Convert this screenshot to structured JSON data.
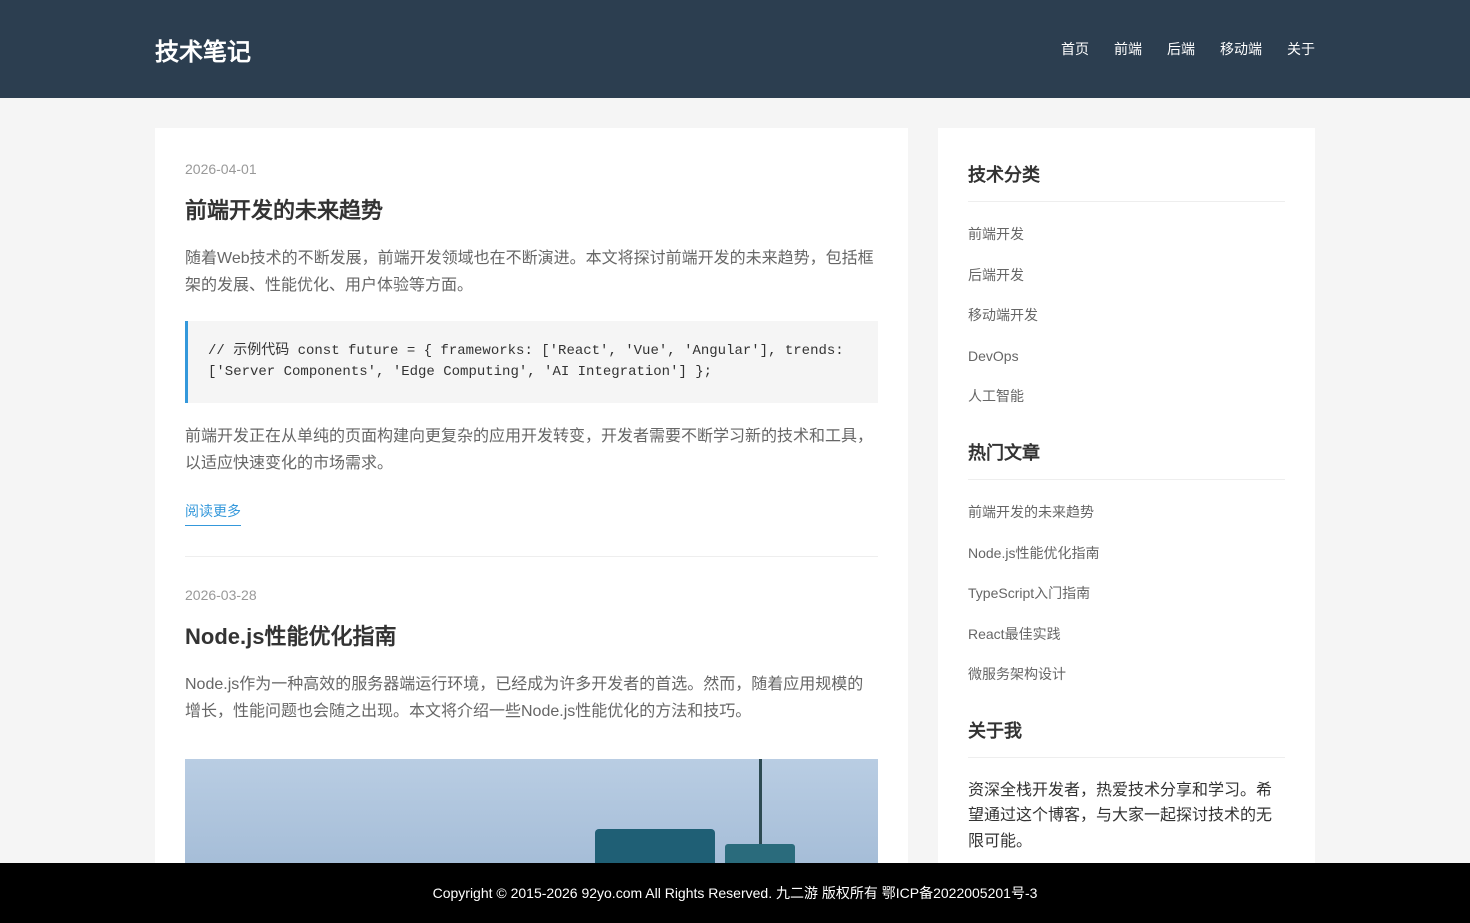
{
  "header": {
    "logo": "技术笔记",
    "nav": [
      "首页",
      "前端",
      "后端",
      "移动端",
      "关于"
    ]
  },
  "posts": [
    {
      "date": "2026-04-01",
      "title": "前端开发的未来趋势",
      "excerpt": "随着Web技术的不断发展，前端开发领域也在不断演进。本文将探讨前端开发的未来趋势，包括框架的发展、性能优化、用户体验等方面。",
      "code": "// 示例代码 const future = { frameworks: ['React', 'Vue', 'Angular'], trends: ['Server Components', 'Edge Computing', 'AI Integration'] };",
      "text2": "前端开发正在从单纯的页面构建向更复杂的应用开发转变，开发者需要不断学习新的技术和工具，以适应快速变化的市场需求。",
      "read_more": "阅读更多"
    },
    {
      "date": "2026-03-28",
      "title": "Node.js性能优化指南",
      "excerpt": "Node.js作为一种高效的服务器端运行环境，已经成为许多开发者的首选。然而，随着应用规模的增长，性能问题也会随之出现。本文将介绍一些Node.js性能优化的方法和技巧。"
    }
  ],
  "sidebar": {
    "categories": {
      "title": "技术分类",
      "items": [
        "前端开发",
        "后端开发",
        "移动端开发",
        "DevOps",
        "人工智能"
      ]
    },
    "popular": {
      "title": "热门文章",
      "items": [
        "前端开发的未来趋势",
        "Node.js性能优化指南",
        "TypeScript入门指南",
        "React最佳实践",
        "微服务架构设计"
      ]
    },
    "about": {
      "title": "关于我",
      "text": "资深全栈开发者，热爱技术分享和学习。希望通过这个博客，与大家一起探讨技术的无限可能。"
    }
  },
  "footer": {
    "copyright": "Copyright © 2015-2026 92yo.com All Rights Reserved. 九二游 版权所有 鄂ICP备2022005201号-3"
  }
}
